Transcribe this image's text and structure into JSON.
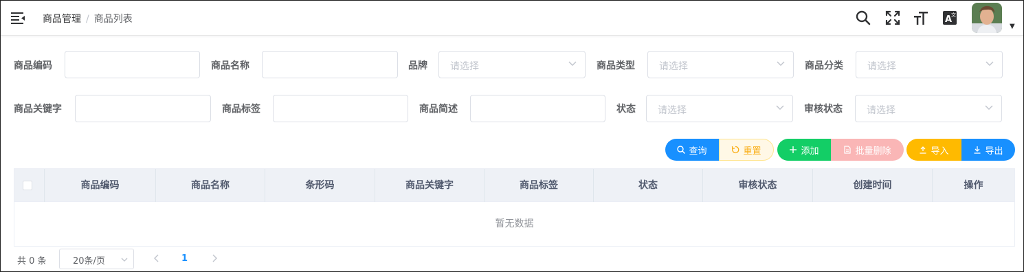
{
  "header": {
    "breadcrumb": [
      "商品管理",
      "商品列表"
    ],
    "separator": "/",
    "icons": [
      "search-icon",
      "fullscreen-icon",
      "font-size-icon",
      "language-icon"
    ]
  },
  "form": {
    "code_label": "商品编码",
    "name_label": "商品名称",
    "brand_label": "品牌",
    "type_label": "商品类型",
    "category_label": "商品分类",
    "keyword_label": "商品关键字",
    "tag_label": "商品标签",
    "brief_label": "商品简述",
    "status_label": "状态",
    "audit_label": "审核状态",
    "select_placeholder": "请选择"
  },
  "actions": {
    "query": "查询",
    "reset": "重置",
    "add": "添加",
    "batch_delete": "批量删除",
    "import": "导入",
    "export": "导出"
  },
  "table": {
    "columns": [
      "商品编码",
      "商品名称",
      "条形码",
      "商品关键字",
      "商品标签",
      "状态",
      "审核状态",
      "创建时间",
      "操作"
    ],
    "empty_text": "暂无数据"
  },
  "pagination": {
    "total": "共 0 条",
    "page_size": "20条/页",
    "current_page": "1"
  },
  "colors": {
    "primary": "#1890ff",
    "success": "#13ce66",
    "danger_light": "#fab6b6",
    "warning": "#ffba00"
  }
}
